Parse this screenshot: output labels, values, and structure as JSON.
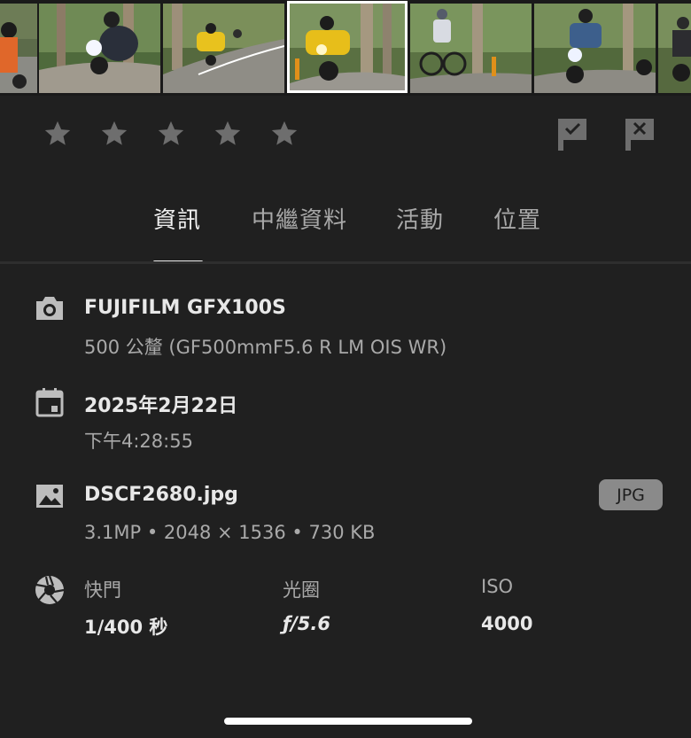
{
  "filmstrip": {
    "thumbnails": [
      {
        "subject": "motorcyclist-orange-jacket",
        "selected": false
      },
      {
        "subject": "motorcyclist-white-headlight",
        "selected": false
      },
      {
        "subject": "yellow-motorcycle",
        "selected": false
      },
      {
        "subject": "yellow-touring-motorcycle",
        "selected": true
      },
      {
        "subject": "cyclist",
        "selected": false
      },
      {
        "subject": "motorcyclist-blue-jacket",
        "selected": false
      },
      {
        "subject": "motorcyclists-pair",
        "selected": false
      }
    ]
  },
  "rating": {
    "stars": 0,
    "max_stars": 5,
    "star_color": "#6e6e6e"
  },
  "flags": {
    "pick_icon": "flag-check-icon",
    "reject_icon": "flag-x-icon"
  },
  "tabs": {
    "items": [
      {
        "label": "資訊",
        "active": true
      },
      {
        "label": "中繼資料",
        "active": false
      },
      {
        "label": "活動",
        "active": false
      },
      {
        "label": "位置",
        "active": false
      }
    ]
  },
  "camera": {
    "icon": "camera-icon",
    "model": "FUJIFILM GFX100S",
    "lens": "500 公釐 (GF500mmF5.6 R LM OIS WR)"
  },
  "capture": {
    "icon": "calendar-icon",
    "date": "2025年2月22日",
    "time": "下午4:28:55"
  },
  "file": {
    "icon": "image-icon",
    "name": "DSCF2680.jpg",
    "details": "3.1MP • 2048 × 1536 • 730 KB",
    "format_badge": "JPG"
  },
  "exposure": {
    "icon": "aperture-icon",
    "shutter_label": "快門",
    "shutter_value": "1/400 秒",
    "aperture_label": "光圈",
    "aperture_value": "ƒ/5.6",
    "iso_label": "ISO",
    "iso_value": "4000"
  },
  "colors": {
    "background": "#202020",
    "text_primary": "#e8e8e8",
    "text_secondary": "#a9a9a9",
    "badge": "#8a8a8a"
  }
}
